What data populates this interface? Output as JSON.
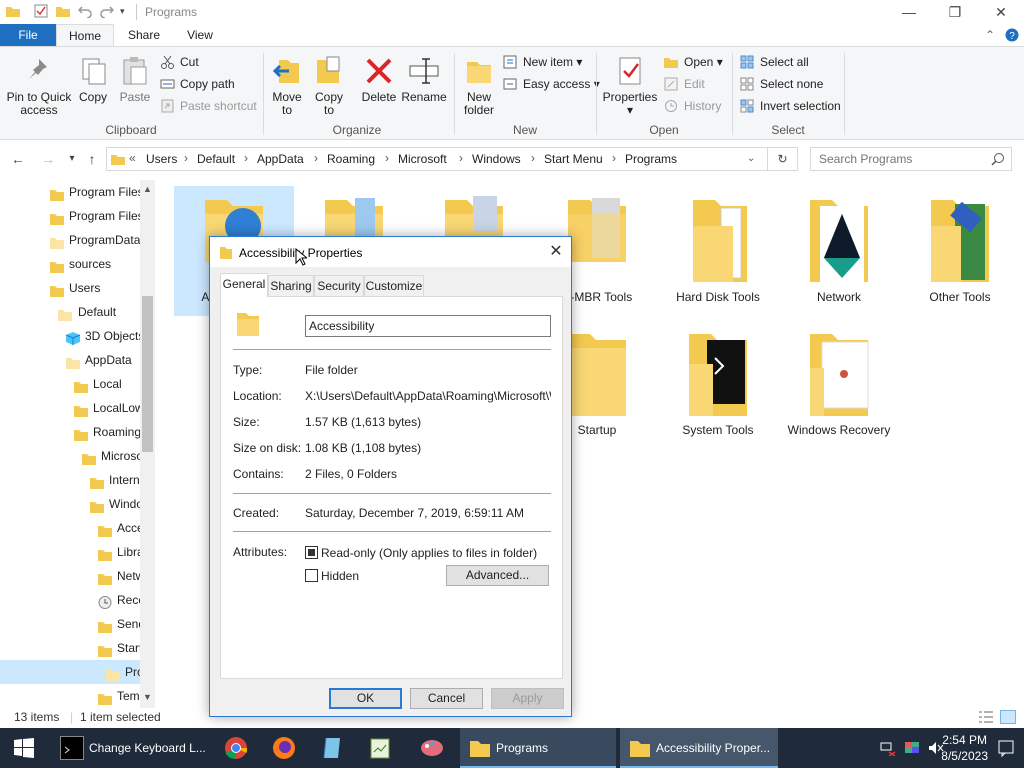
{
  "window": {
    "title": "Programs",
    "ribbon_tabs": [
      "File",
      "Home",
      "Share",
      "View"
    ]
  },
  "ribbon": {
    "clipboard": {
      "pin": "Pin to Quick access",
      "copy": "Copy",
      "paste": "Paste",
      "cut": "Cut",
      "copy_path": "Copy path",
      "paste_shortcut": "Paste shortcut",
      "label": "Clipboard"
    },
    "organize": {
      "move_to": "Move to",
      "copy_to": "Copy to",
      "delete": "Delete",
      "rename": "Rename",
      "label": "Organize"
    },
    "new": {
      "new_folder": "New folder",
      "new_item": "New item",
      "easy_access": "Easy access",
      "label": "New"
    },
    "open": {
      "properties": "Properties",
      "open": "Open",
      "edit": "Edit",
      "history": "History",
      "label": "Open"
    },
    "select": {
      "select_all": "Select all",
      "select_none": "Select none",
      "invert": "Invert selection",
      "label": "Select"
    }
  },
  "address": {
    "overflow": "«",
    "crumbs": [
      "Users",
      "Default",
      "AppData",
      "Roaming",
      "Microsoft",
      "Windows",
      "Start Menu",
      "Programs"
    ],
    "search_placeholder": "Search Programs"
  },
  "nav": {
    "items": [
      {
        "label": "Program Files"
      },
      {
        "label": "Program Files"
      },
      {
        "label": "ProgramData"
      },
      {
        "label": "sources"
      },
      {
        "label": "Users"
      },
      {
        "label": "Default"
      },
      {
        "label": "3D Objects"
      },
      {
        "label": "AppData"
      },
      {
        "label": "Local"
      },
      {
        "label": "LocalLow"
      },
      {
        "label": "Roaming"
      },
      {
        "label": "Microsoft"
      },
      {
        "label": "Internet"
      },
      {
        "label": "Windows"
      },
      {
        "label": "Accessibility"
      },
      {
        "label": "Libraries"
      },
      {
        "label": "Network Shortcuts"
      },
      {
        "label": "Recent"
      },
      {
        "label": "SendTo"
      },
      {
        "label": "Start Menu"
      },
      {
        "label": "Programs"
      },
      {
        "label": "Templates"
      }
    ]
  },
  "content": {
    "items": [
      {
        "name": "Accessibility"
      },
      {
        "name": ""
      },
      {
        "name": ""
      },
      {
        "name": "D-MBR Tools"
      },
      {
        "name": "Hard Disk Tools"
      },
      {
        "name": "Network"
      },
      {
        "name": "Other Tools"
      },
      {
        "name": "Startup"
      },
      {
        "name": "System Tools"
      },
      {
        "name": "Windows Recovery"
      }
    ]
  },
  "status": {
    "count": "13 items",
    "selected": "1 item selected"
  },
  "taskbar": {
    "cmd": "Change Keyboard L...",
    "programs": "Programs",
    "props": "Accessibility Proper...",
    "time": "2:54 PM",
    "date": "8/5/2023"
  },
  "dialog": {
    "title": "Accessibility Properties",
    "tabs": [
      "General",
      "Sharing",
      "Security",
      "Customize"
    ],
    "name": "Accessibility",
    "labels": {
      "type": "Type:",
      "location": "Location:",
      "size": "Size:",
      "size_on_disk": "Size on disk:",
      "contains": "Contains:",
      "created": "Created:",
      "attributes": "Attributes:"
    },
    "values": {
      "type": "File folder",
      "location": "X:\\Users\\Default\\AppData\\Roaming\\Microsoft\\Windows\\Start Menu\\Programs",
      "size": "1.57 KB (1,613 bytes)",
      "size_on_disk": "1.08 KB (1,108 bytes)",
      "contains": "2 Files, 0 Folders",
      "created": "Saturday, December 7, 2019, 6:59:11 AM"
    },
    "readonly": "Read-only (Only applies to files in folder)",
    "hidden": "Hidden",
    "advanced": "Advanced...",
    "ok": "OK",
    "cancel": "Cancel",
    "apply": "Apply"
  }
}
